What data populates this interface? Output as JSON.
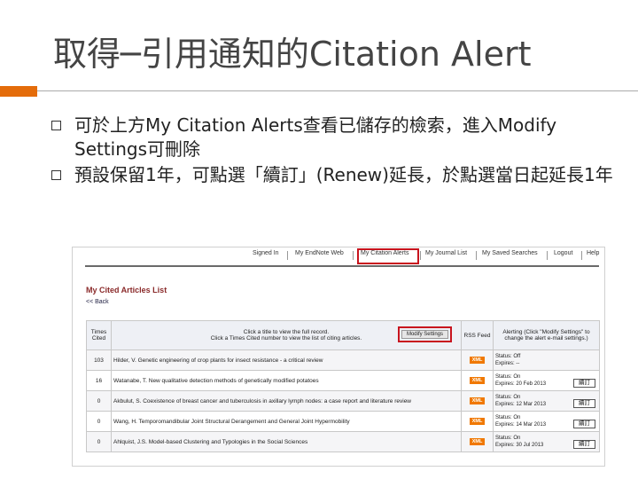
{
  "slide": {
    "title": "取得─引用通知的Citation Alert",
    "bullets": [
      "可於上方My Citation Alerts查看已儲存的檢索，進入Modify Settings可刪除",
      "預設保留1年，可點選「續訂」(Renew)延長，於點選當日起延長1年"
    ],
    "accent_color": "#e46c0a"
  },
  "screenshot": {
    "nav": [
      "Signed In",
      "My EndNote Web",
      "My Citation Alerts",
      "My Journal List",
      "My Saved Searches",
      "Logout",
      "Help"
    ],
    "list_title": "My Cited Articles List",
    "back_link": "<< Back",
    "headers": {
      "times_cited": "Times Cited",
      "instructions_line1": "Click a title to view the full record.",
      "instructions_line2": "Click a Times Cited number to view the list of citing articles.",
      "modify_button": "Modify Settings",
      "rss": "RSS Feed",
      "alerting": "Alerting (Click \"Modify Settings\" to change the alert e-mail settings.)"
    },
    "rows": [
      {
        "times": "103",
        "title": "Hilder, V. Genetic engineering of crop plants for insect resistance - a critical review",
        "xml": "XML",
        "status": "Status: Off",
        "expires": "Expires: --",
        "renew": ""
      },
      {
        "times": "16",
        "title": "Watanabe, T. New qualitative detection methods of genetically modified potatoes",
        "xml": "XML",
        "status": "Status: On",
        "expires": "Expires: 20 Feb 2013",
        "renew": "續訂"
      },
      {
        "times": "0",
        "title": "Akbulut, S. Coexistence of breast cancer and tuberculosis in axillary lymph nodes: a case report and literature review",
        "xml": "XML",
        "status": "Status: On",
        "expires": "Expires: 12 Mar 2013",
        "renew": "續訂"
      },
      {
        "times": "0",
        "title": "Wang, H. Temporomandibular Joint Structural Derangement and General Joint Hypermobility",
        "xml": "XML",
        "status": "Status: On",
        "expires": "Expires: 14 Mar 2013",
        "renew": "續訂"
      },
      {
        "times": "0",
        "title": "Ahlquist, J.S. Model-based Clustering and Typologies in the Social Sciences",
        "xml": "XML",
        "status": "Status: On",
        "expires": "Expires: 30 Jul 2013",
        "renew": "續訂"
      }
    ]
  }
}
